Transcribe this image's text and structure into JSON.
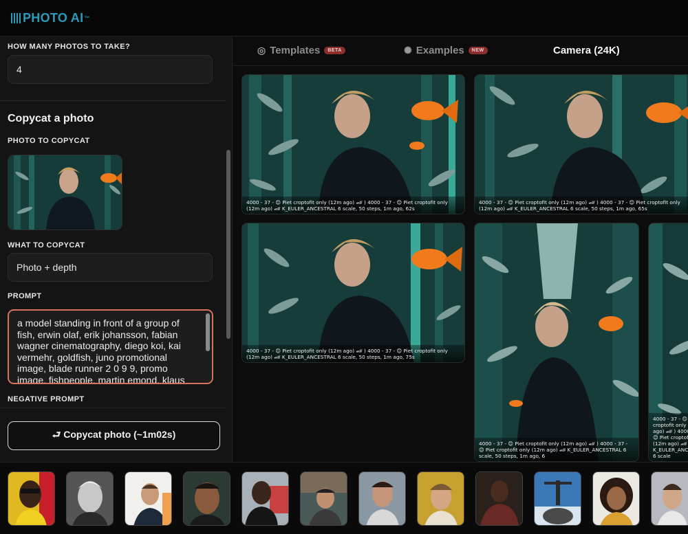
{
  "app": {
    "logo_text": "PHOTO AI",
    "logo_mark": "™",
    "accent": "#2a9bb8"
  },
  "left_panel": {
    "photos_label": "HOW MANY PHOTOS TO TAKE?",
    "photos_value": "4",
    "section_title": "Copycat a photo",
    "photo_to_copycat_label": "PHOTO TO COPYCAT",
    "what_to_copycat_label": "WHAT TO COPYCAT",
    "what_to_copycat_value": "Photo + depth",
    "prompt_label": "PROMPT",
    "prompt_value": "a model standing in front of a group of fish, erwin olaf, erik johansson, fabian wagner cinematography, diego koi, kai vermehr, goldfish, juno promotional image, blade runner 2 0 9 9, promo image, fishpeople, martin emond, klaus",
    "negative_prompt_label": "NEGATIVE PROMPT",
    "copycat_button": "⮐ Copycat photo (~1m02s)"
  },
  "tabs": [
    {
      "label": "Templates",
      "icon": "spiral-icon",
      "icon_glyph": "◎",
      "badge": "BETA",
      "active": false
    },
    {
      "label": "Examples",
      "icon": "sparkle-icon",
      "icon_glyph": "✺",
      "badge": "NEW",
      "active": false
    },
    {
      "label": "Camera (24K)",
      "active": true
    }
  ],
  "results": [
    {
      "caption": "4000 - 37 - 😊 Piet croptofit only (12m ago) 🏎 ) 4000 - 37 - 😊 Piet croptofit only (12m ago) 🏎 K_EULER_ANCESTRAL 6 scale, 50 steps, 1m ago, 62s"
    },
    {
      "caption": "4000 - 37 - 😊 Piet croptofit only (12m ago) 🏎 ) 4000 - 37 - 😊 Piet croptofit only (12m ago) 🏎 K_EULER_ANCESTRAL 6 scale, 50 steps, 1m ago, 65s"
    },
    {
      "caption": "4000 - 37 - 😊 Piet croptofit only (12m ago) 🏎 ) 4000 - 37 - 😊 Piet croptofit only (12m ago) 🏎 K_EULER_ANCESTRAL 6 scale, 50 steps, 1m ago, 75s"
    },
    {
      "caption": "4000 - 37 - 😊 Piet croptofit only (12m ago) 🏎 ) 4000 - 37 - 😊 Piet croptofit only (12m ago) 🏎 K_EULER_ANCESTRAL 6 scale, 50 steps, 1m ago, 6"
    },
    {
      "caption": "4000 - 37 - 😊 Piet croptofit only (12m ago) 🏎 ) 4000 - 37 - 😊 Piet croptofit only (12m ago) 🏎 K_EULER_ANCESTRAL 6 scale"
    }
  ],
  "colors": {
    "prompt_border": "#d4735e",
    "badge_bg": "#8a2e2e",
    "aquarium_teal": "#1f5a56",
    "goldfish": "#f07a1c"
  }
}
